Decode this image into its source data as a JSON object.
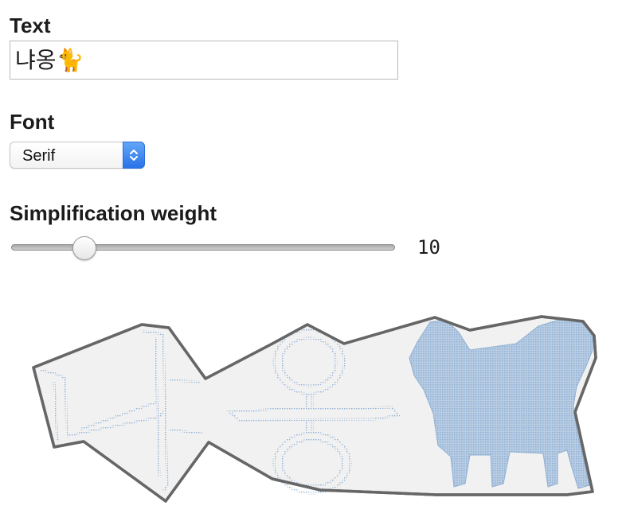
{
  "text_section": {
    "label": "Text",
    "value": "냐옹🐈"
  },
  "font_section": {
    "label": "Font",
    "selected": "Serif"
  },
  "weight_section": {
    "label": "Simplification weight",
    "value": "10",
    "fraction": 0.19
  },
  "preview": {
    "outline_color": "#666666",
    "fill_color": "#f1f1f1",
    "dot_color": "#8fb0d4",
    "cat_color": "#a8c1dc"
  }
}
